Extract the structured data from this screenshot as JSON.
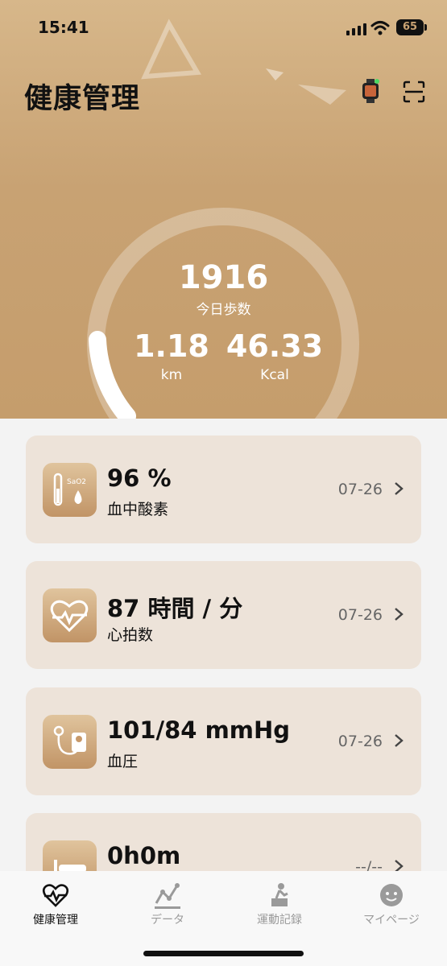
{
  "status_bar": {
    "time": "15:41",
    "battery": "65"
  },
  "header": {
    "title": "健康管理"
  },
  "summary": {
    "steps_value": "1916",
    "steps_label": "今日歩数",
    "distance_value": "1.18",
    "distance_unit": "km",
    "calories_value": "46.33",
    "calories_unit": "Kcal"
  },
  "cards": [
    {
      "value": "96 %",
      "label": "血中酸素",
      "date": "07-26",
      "icon": "blood-oxygen-icon",
      "badge": "SaO2"
    },
    {
      "value": "87 時間 / 分",
      "label": "心拍数",
      "date": "07-26",
      "icon": "heart-rate-icon"
    },
    {
      "value": "101/84 mmHg",
      "label": "血圧",
      "date": "07-26",
      "icon": "blood-pressure-icon"
    },
    {
      "value": "0h0m",
      "label": "",
      "date": "--/--",
      "icon": "sleep-icon"
    }
  ],
  "tabs": [
    {
      "label": "健康管理",
      "icon": "heart-pulse-icon",
      "active": true
    },
    {
      "label": "データ",
      "icon": "data-chart-icon",
      "active": false
    },
    {
      "label": "運動記録",
      "icon": "exercise-icon",
      "active": false
    },
    {
      "label": "マイページ",
      "icon": "profile-icon",
      "active": false
    }
  ],
  "colors": {
    "accent": "#c59d6c",
    "card_bg": "#ede3d9",
    "active_tab": "#111111",
    "inactive_tab": "#9a9a9a"
  }
}
